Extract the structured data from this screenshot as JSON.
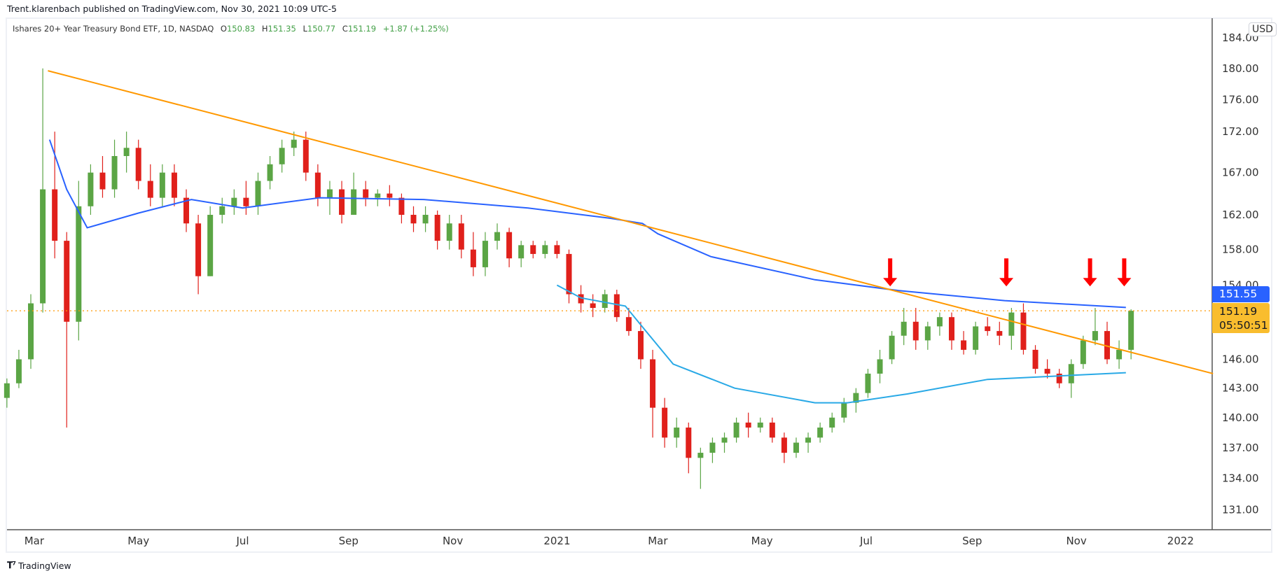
{
  "header": {
    "published": "Trent.klarenbach published on TradingView.com, Nov 30, 2021 10:09 UTC-5",
    "symbol": "Ishares 20+ Year Treasury Bond ETF, 1D, NASDAQ",
    "open_label": "O",
    "open": "150.83",
    "high_label": "H",
    "high": "151.35",
    "low_label": "L",
    "low": "150.77",
    "close_label": "C",
    "close": "151.19",
    "change": "+1.87 (+1.25%)"
  },
  "currency": "USD",
  "last_price_label": "151.19",
  "countdown": "05:50:51",
  "ma_long_label": "151.55",
  "footer": {
    "brand": "TradingView"
  },
  "colors": {
    "up": "#5ba545",
    "down": "#e0201b",
    "trendline": "#ff9800",
    "ma_long": "#2962ff",
    "ma_short": "#29a9e6",
    "arrow": "#ff0000"
  },
  "chart_data": {
    "type": "candlestick",
    "title": "Ishares 20+ Year Treasury Bond ETF, 1D, NASDAQ",
    "interval_of_points": "1W (approximated from daily candles)",
    "x_start": "2020-02-14",
    "ohlc": [
      [
        142,
        144,
        141,
        143.5
      ],
      [
        143.5,
        147,
        143,
        146
      ],
      [
        146,
        153,
        145,
        152
      ],
      [
        152,
        180,
        151,
        165
      ],
      [
        165,
        172,
        157,
        159
      ],
      [
        159,
        160,
        139,
        150
      ],
      [
        150,
        166,
        148,
        163
      ],
      [
        163,
        168,
        162,
        167
      ],
      [
        167,
        169,
        164,
        165
      ],
      [
        165,
        171,
        164,
        169
      ],
      [
        169,
        172,
        167,
        170
      ],
      [
        170,
        171,
        165,
        166
      ],
      [
        166,
        168,
        163,
        164
      ],
      [
        164,
        168,
        163,
        167
      ],
      [
        167,
        168,
        163,
        164
      ],
      [
        164,
        165,
        160,
        161
      ],
      [
        161,
        162,
        153,
        155
      ],
      [
        155,
        163,
        155,
        162
      ],
      [
        162,
        164,
        161,
        163
      ],
      [
        163,
        165,
        162,
        164
      ],
      [
        164,
        166,
        162,
        163
      ],
      [
        163,
        167,
        162,
        166
      ],
      [
        166,
        169,
        165,
        168
      ],
      [
        168,
        171,
        167,
        170
      ],
      [
        170,
        172,
        169,
        171
      ],
      [
        171,
        172,
        166,
        167
      ],
      [
        167,
        168,
        163,
        164
      ],
      [
        164,
        166,
        162,
        165
      ],
      [
        165,
        166,
        161,
        162
      ],
      [
        162,
        167,
        162,
        165
      ],
      [
        165,
        166,
        163,
        164
      ],
      [
        164,
        165,
        163,
        164.5
      ],
      [
        164.5,
        165.5,
        163,
        164
      ],
      [
        164,
        164.5,
        161,
        162
      ],
      [
        162,
        163,
        160,
        161
      ],
      [
        161,
        163,
        160,
        162
      ],
      [
        162,
        162.5,
        158,
        159
      ],
      [
        159,
        162,
        158,
        161
      ],
      [
        161,
        162,
        157,
        158
      ],
      [
        158,
        160,
        155,
        156
      ],
      [
        156,
        160,
        155,
        159
      ],
      [
        159,
        161,
        158,
        160
      ],
      [
        160,
        160.5,
        156,
        157
      ],
      [
        157,
        159,
        156,
        158.5
      ],
      [
        158.5,
        159,
        157,
        157.5
      ],
      [
        157.5,
        159,
        157,
        158.5
      ],
      [
        158.5,
        159,
        157,
        157.5
      ],
      [
        157.5,
        158,
        152,
        153
      ],
      [
        153,
        154,
        151,
        152
      ],
      [
        152,
        153,
        150.5,
        151.5
      ],
      [
        151.5,
        153.5,
        151,
        153
      ],
      [
        153,
        153.5,
        150,
        150.5
      ],
      [
        150.5,
        151.5,
        148.5,
        149
      ],
      [
        149,
        150,
        145,
        146
      ],
      [
        146,
        147,
        138,
        141
      ],
      [
        141,
        142,
        137,
        138
      ],
      [
        138,
        140,
        137,
        139
      ],
      [
        139,
        139.5,
        134.5,
        136
      ],
      [
        136,
        137,
        133,
        136.5
      ],
      [
        136.5,
        138,
        135.5,
        137.5
      ],
      [
        137.5,
        138.5,
        136.5,
        138
      ],
      [
        138,
        140,
        137.5,
        139.5
      ],
      [
        139.5,
        140.5,
        138,
        139
      ],
      [
        139,
        140,
        138.5,
        139.5
      ],
      [
        139.5,
        140,
        137.5,
        138
      ],
      [
        138,
        138.5,
        135.5,
        136.5
      ],
      [
        136.5,
        138,
        136,
        137.5
      ],
      [
        137.5,
        138.5,
        136.5,
        138
      ],
      [
        138,
        139.5,
        137.5,
        139
      ],
      [
        139,
        140.5,
        138.5,
        140
      ],
      [
        140,
        142,
        139.5,
        141.5
      ],
      [
        141.5,
        143,
        140.5,
        142.5
      ],
      [
        142.5,
        145,
        142,
        144.5
      ],
      [
        144.5,
        147,
        143.5,
        146
      ],
      [
        146,
        149,
        145.5,
        148.5
      ],
      [
        148.5,
        151.5,
        147.5,
        150
      ],
      [
        150,
        151.5,
        147,
        148
      ],
      [
        148,
        150,
        147,
        149.5
      ],
      [
        149.5,
        151,
        148.5,
        150.5
      ],
      [
        150.5,
        151,
        147,
        148
      ],
      [
        148,
        149,
        146.5,
        147
      ],
      [
        147,
        150,
        146.5,
        149.5
      ],
      [
        149.5,
        150.5,
        148.5,
        149
      ],
      [
        149,
        150,
        147.5,
        148.5
      ],
      [
        148.5,
        151.5,
        147,
        151
      ],
      [
        151,
        152,
        146.5,
        147
      ],
      [
        147,
        147.5,
        144.5,
        145
      ],
      [
        145,
        146,
        144,
        144.5
      ],
      [
        144.5,
        145,
        143,
        143.5
      ],
      [
        143.5,
        146,
        142,
        145.5
      ],
      [
        145.5,
        148.5,
        145,
        148
      ],
      [
        148,
        151.5,
        147.5,
        149
      ],
      [
        149,
        150,
        145.5,
        146
      ],
      [
        146,
        148,
        145,
        147
      ],
      [
        147,
        151.35,
        146,
        151.19
      ]
    ],
    "ma_long": {
      "name": "MA (long)",
      "last": 151.55,
      "points": [
        [
          "2020-03-10",
          171
        ],
        [
          "2020-03-20",
          165
        ],
        [
          "2020-04-01",
          160.5
        ],
        [
          "2020-05-01",
          162.2
        ],
        [
          "2020-06-01",
          163.8
        ],
        [
          "2020-07-01",
          162.8
        ],
        [
          "2020-08-15",
          164
        ],
        [
          "2020-10-15",
          163.8
        ],
        [
          "2020-12-15",
          162.8
        ],
        [
          "2021-02-01",
          161.6
        ],
        [
          "2021-02-20",
          161
        ],
        [
          "2021-03-01",
          159.8
        ],
        [
          "2021-04-01",
          157.2
        ],
        [
          "2021-06-01",
          154.6
        ],
        [
          "2021-07-20",
          153.4
        ],
        [
          "2021-09-20",
          152.3
        ],
        [
          "2021-11-30",
          151.55
        ]
      ]
    },
    "ma_short": {
      "name": "MA (short)",
      "points": [
        [
          "2021-01-01",
          154
        ],
        [
          "2021-01-15",
          152.6
        ],
        [
          "2021-02-10",
          151.7
        ],
        [
          "2021-02-22",
          149
        ],
        [
          "2021-03-10",
          145.5
        ],
        [
          "2021-04-15",
          143
        ],
        [
          "2021-06-01",
          141.5
        ],
        [
          "2021-06-20",
          141.5
        ],
        [
          "2021-07-25",
          142.4
        ],
        [
          "2021-09-10",
          143.9
        ],
        [
          "2021-11-30",
          144.6
        ]
      ]
    },
    "trendline": {
      "from": [
        "2020-03-09",
        179.7
      ],
      "to": [
        "2022-01-20",
        144.5
      ],
      "color": "#ff9800"
    },
    "last_price_line": 151.19,
    "annotations": [
      {
        "type": "down-arrow",
        "date": "2021-07-15",
        "price": 157
      },
      {
        "type": "down-arrow",
        "date": "2021-09-21",
        "price": 157
      },
      {
        "type": "down-arrow",
        "date": "2021-11-09",
        "price": 157
      },
      {
        "type": "down-arrow",
        "date": "2021-11-29",
        "price": 157
      }
    ],
    "y_ticks": [
      "184.00",
      "180.00",
      "176.00",
      "172.00",
      "167.00",
      "162.00",
      "158.00",
      "154.00",
      "146.00",
      "143.00",
      "140.00",
      "137.00",
      "134.00",
      "131.00"
    ],
    "x_ticks": [
      [
        "Mar",
        "2020-03-01"
      ],
      [
        "May",
        "2020-05-01"
      ],
      [
        "Jul",
        "2020-07-01"
      ],
      [
        "Sep",
        "2020-09-01"
      ],
      [
        "Nov",
        "2020-11-01"
      ],
      [
        "2021",
        "2021-01-01"
      ],
      [
        "Mar",
        "2021-03-01"
      ],
      [
        "May",
        "2021-05-01"
      ],
      [
        "Jul",
        "2021-07-01"
      ],
      [
        "Sep",
        "2021-09-01"
      ],
      [
        "Nov",
        "2021-11-01"
      ],
      [
        "2022",
        "2022-01-01"
      ]
    ],
    "ylim": [
      129,
      185
    ],
    "xlabel": "",
    "ylabel": "USD",
    "grid": false,
    "scale": "log"
  }
}
